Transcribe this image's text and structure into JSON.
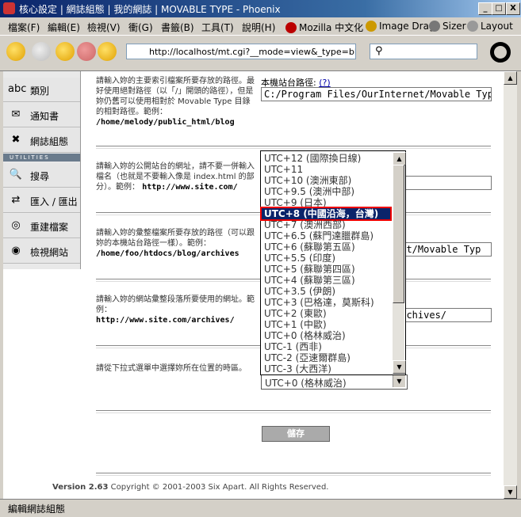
{
  "window": {
    "title": "核心設定 | 網誌組態 | 我的網誌 | MOVABLE TYPE - Phoenix",
    "minimize": "_",
    "maximize": "□",
    "close": "X"
  },
  "menu": {
    "items": [
      "檔案(F)",
      "編輯(E)",
      "檢視(V)",
      "衝(G)",
      "書籤(B)",
      "工具(T)",
      "說明(H)"
    ],
    "toolbar_links": [
      "Mozilla 中文化",
      "Image Drag",
      "Sizer",
      "Layout"
    ]
  },
  "nav": {
    "url": "http://localhost/mt.cgi?__mode=view&_type=blog&id=",
    "search_placeholder": ""
  },
  "sidebar": {
    "items": [
      {
        "label": "類別",
        "icon": "abc"
      },
      {
        "label": "通知書",
        "icon": "✉"
      },
      {
        "label": "網誌組態",
        "icon": "✖"
      }
    ],
    "utilities_label": "UTILITIES",
    "util_items": [
      {
        "label": "搜尋",
        "icon": "🔍"
      },
      {
        "label": "匯入 / 匯出",
        "icon": "⇄"
      },
      {
        "label": "重建檔案",
        "icon": "◎"
      },
      {
        "label": "檢視網站",
        "icon": "◉"
      }
    ]
  },
  "form": {
    "site_path": {
      "desc": "請輸入妳的主要索引檔案所要存放的路徑。最好使用絕對路徑（以「/」開頭的路徑），但是妳仍舊可以使用相對於 Movable Type 目錄的相對路徑。範例：",
      "example": "/home/melody/public_html/blog",
      "label": "本機站台路徑:",
      "help": "(?)",
      "value": "C:/Program Files/OurInternet/Movable Typ"
    },
    "site_url": {
      "desc": "請輸入妳的公開站台的網址，請不要一併輸入檔名（也就是不要輸入像是 index.html 的部分）。範例：",
      "example": "http://www.site.com/"
    },
    "archive_path": {
      "desc": "請輸入妳的彙整檔案所要存放的路徑（可以跟妳的本機站台路徑一樣）。範例：",
      "example": "/home/foo/htdocs/blog/archives",
      "value": "net/Movable Typ"
    },
    "archive_url": {
      "desc": "請輸入妳的網站彙整段落所要使用的網址。範例：",
      "example": "http://www.site.com/archives/",
      "value": "archives/"
    },
    "timezone": {
      "desc": "請從下拉式選單中選擇妳所在位置的時區。",
      "selected": "UTC+0 (格林威治)",
      "options": [
        "UTC+12 (國際換日線)",
        "UTC+11",
        "UTC+10 (澳洲東部)",
        "UTC+9.5 (澳洲中部)",
        "UTC+9 (日本)",
        "UTC+8 (中國沿海，台灣)",
        "UTC+7 (澳洲西部)",
        "UTC+6.5 (蘇門達臘群島)",
        "UTC+6 (蘇聯第五區)",
        "UTC+5.5 (印度)",
        "UTC+5 (蘇聯第四區)",
        "UTC+4 (蘇聯第三區)",
        "UTC+3.5 (伊朗)",
        "UTC+3 (巴格達，莫斯科)",
        "UTC+2 (東歐)",
        "UTC+1 (中歐)",
        "UTC+0 (格林威治)",
        "UTC-1 (西非)",
        "UTC-2 (亞速爾群島)",
        "UTC-3 (大西洋)"
      ],
      "highlighted_index": 5
    },
    "save_label": "儲存"
  },
  "footer": {
    "version": "Version 2.63",
    "copyright": "Copyright © 2001-2003 Six Apart. All Rights Reserved."
  },
  "status": {
    "text": "編輯網誌組態"
  }
}
